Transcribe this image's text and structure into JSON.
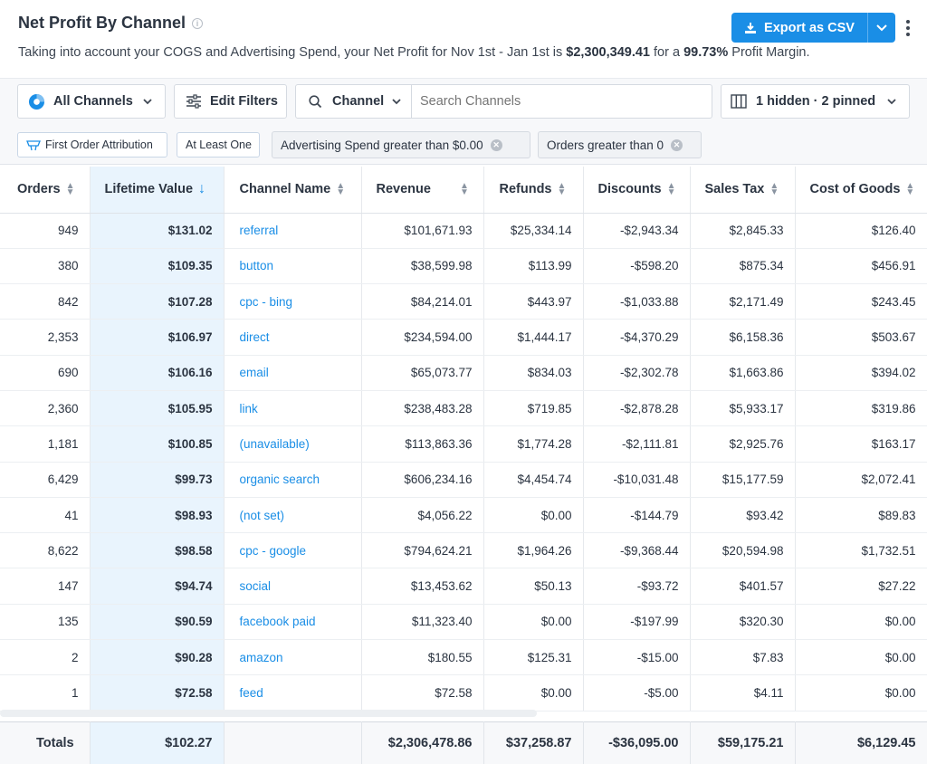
{
  "header": {
    "title": "Net Profit By Channel",
    "subtitle_pre": "Taking into account your COGS and Advertising Spend, your Net Profit for Nov 1st - Jan 1st is ",
    "net_profit": "$2,300,349.41",
    "subtitle_mid": " for a ",
    "profit_margin": "99.73%",
    "subtitle_post": " Profit Margin.",
    "export_label": "Export as CSV"
  },
  "toolbar": {
    "channels_label": "All Channels",
    "edit_filters_label": "Edit Filters",
    "search_field_label": "Channel",
    "search_placeholder": "Search Channels",
    "columns_label": "1 hidden · 2 pinned"
  },
  "filters": [
    "First Order Attribution",
    "At Least One",
    "Advertising Spend greater than $0.00",
    "Orders greater than 0"
  ],
  "table": {
    "headers": [
      "Orders",
      "Lifetime Value",
      "Channel Name",
      "Revenue",
      "Refunds",
      "Discounts",
      "Sales Tax",
      "Cost of Goods"
    ],
    "rows": [
      [
        "949",
        "$131.02",
        "referral",
        "$101,671.93",
        "$25,334.14",
        "-$2,943.34",
        "$2,845.33",
        "$126.40"
      ],
      [
        "380",
        "$109.35",
        "button",
        "$38,599.98",
        "$113.99",
        "-$598.20",
        "$875.34",
        "$456.91"
      ],
      [
        "842",
        "$107.28",
        "cpc - bing",
        "$84,214.01",
        "$443.97",
        "-$1,033.88",
        "$2,171.49",
        "$243.45"
      ],
      [
        "2,353",
        "$106.97",
        "direct",
        "$234,594.00",
        "$1,444.17",
        "-$4,370.29",
        "$6,158.36",
        "$503.67"
      ],
      [
        "690",
        "$106.16",
        "email",
        "$65,073.77",
        "$834.03",
        "-$2,302.78",
        "$1,663.86",
        "$394.02"
      ],
      [
        "2,360",
        "$105.95",
        "link",
        "$238,483.28",
        "$719.85",
        "-$2,878.28",
        "$5,933.17",
        "$319.86"
      ],
      [
        "1,181",
        "$100.85",
        "(unavailable)",
        "$113,863.36",
        "$1,774.28",
        "-$2,111.81",
        "$2,925.76",
        "$163.17"
      ],
      [
        "6,429",
        "$99.73",
        "organic search",
        "$606,234.16",
        "$4,454.74",
        "-$10,031.48",
        "$15,177.59",
        "$2,072.41"
      ],
      [
        "41",
        "$98.93",
        "(not set)",
        "$4,056.22",
        "$0.00",
        "-$144.79",
        "$93.42",
        "$89.83"
      ],
      [
        "8,622",
        "$98.58",
        "cpc - google",
        "$794,624.21",
        "$1,964.26",
        "-$9,368.44",
        "$20,594.98",
        "$1,732.51"
      ],
      [
        "147",
        "$94.74",
        "social",
        "$13,453.62",
        "$50.13",
        "-$93.72",
        "$401.57",
        "$27.22"
      ],
      [
        "135",
        "$90.59",
        "facebook paid",
        "$11,323.40",
        "$0.00",
        "-$197.99",
        "$320.30",
        "$0.00"
      ],
      [
        "2",
        "$90.28",
        "amazon",
        "$180.55",
        "$125.31",
        "-$15.00",
        "$7.83",
        "$0.00"
      ],
      [
        "1",
        "$72.58",
        "feed",
        "$72.58",
        "$0.00",
        "-$5.00",
        "$4.11",
        "$0.00"
      ]
    ],
    "totals": [
      "Totals",
      "$102.27",
      "",
      "$2,306,478.86",
      "$37,258.87",
      "-$36,095.00",
      "$59,175.21",
      "$6,129.45"
    ]
  },
  "colors": {
    "accent": "#1a8ee6",
    "pinned_bg": "#e9f4fd"
  }
}
